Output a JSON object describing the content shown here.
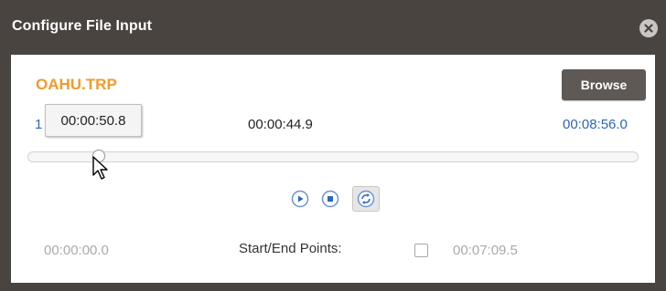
{
  "dialog": {
    "title": "Configure File Input"
  },
  "file": {
    "name": "OAHU.TRP",
    "browse_label": "Browse"
  },
  "timeline": {
    "start_label_visible": "1",
    "current_time": "00:00:44.9",
    "total_time": "00:08:56.0",
    "tooltip_time": "00:00:50.8",
    "position_fraction": 0.108
  },
  "controls": {
    "play": "play-icon",
    "stop": "stop-icon",
    "loop": "loop-icon"
  },
  "points": {
    "start_time": "00:00:00.0",
    "label": "Start/End Points:",
    "checked": false,
    "end_time": "00:07:09.5"
  },
  "colors": {
    "titlebar": "#4a4440",
    "accent_orange": "#f39a2b",
    "time_blue": "#2e66b8",
    "button": "#5e5955"
  }
}
